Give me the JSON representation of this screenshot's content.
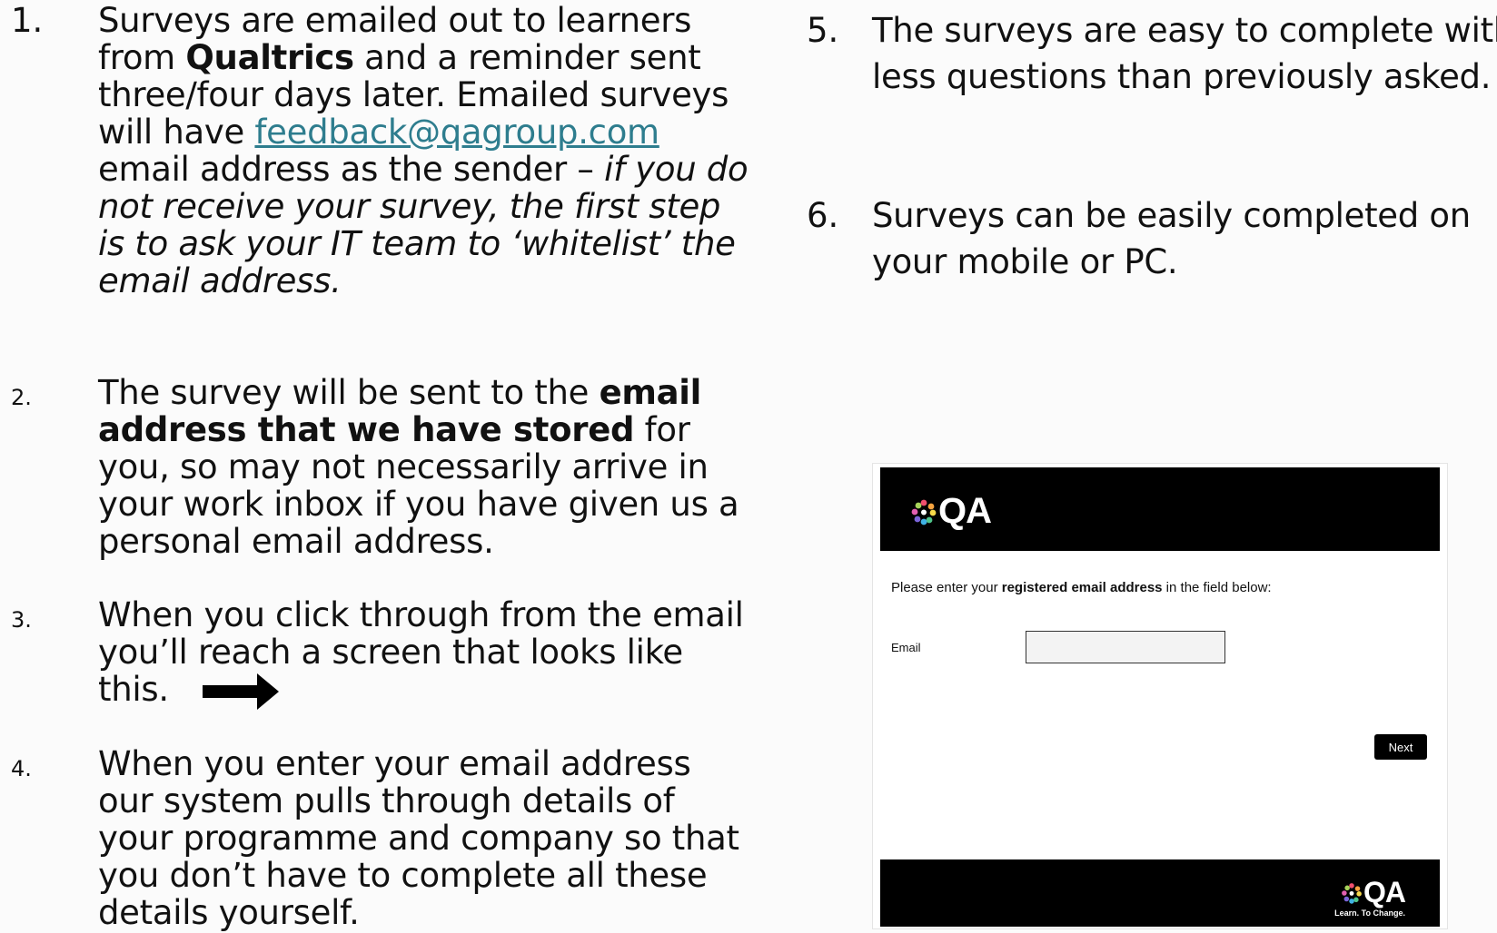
{
  "items": [
    {
      "number": "1.",
      "segments": [
        {
          "text": "Surveys are emailed out to learners from ",
          "style": "normal"
        },
        {
          "text": "Qualtrics",
          "style": "bold"
        },
        {
          "text": " and a reminder sent three/four days later. Emailed surveys will have ",
          "style": "normal"
        },
        {
          "text": "feedback@qagroup.com",
          "style": "link"
        },
        {
          "text": " email address as the sender – ",
          "style": "normal"
        },
        {
          "text": "if you do not receive your survey, the first step is to ask your IT team to ‘whitelist’ the email address.",
          "style": "italic"
        }
      ]
    },
    {
      "number": "2.",
      "segments": [
        {
          "text": "The survey will be sent to the ",
          "style": "normal"
        },
        {
          "text": "email address that we have stored",
          "style": "bold"
        },
        {
          "text": " for you, so may not necessarily arrive in your work inbox if you have given us a personal email address.",
          "style": "normal"
        }
      ]
    },
    {
      "number": "3.",
      "segments": [
        {
          "text": "When you click through from the email you’ll reach a screen that looks like this.",
          "style": "normal"
        }
      ]
    },
    {
      "number": "4.",
      "segments": [
        {
          "text": "When you enter your email address our system pulls through details of your programme and company so that you don’t have to complete all these details yourself.",
          "style": "normal"
        }
      ]
    },
    {
      "number": "5.",
      "segments": [
        {
          "text": "The surveys are easy to complete with less questions than previously asked.",
          "style": "normal"
        }
      ]
    },
    {
      "number": "6.",
      "segments": [
        {
          "text": "Surveys can be easily completed on your mobile or PC.",
          "style": "normal"
        }
      ]
    }
  ],
  "arrow_icon": "right-arrow-icon",
  "survey": {
    "logo_text": "QA",
    "footer_logo_text": "QA",
    "footer_tagline": "Learn. To Change.",
    "prompt": {
      "before": "Please enter your ",
      "bold": "registered email address",
      "after": " in the field below:"
    },
    "email_label": "Email",
    "email_value": "",
    "next_label": "Next",
    "logo_dot_colors": [
      "#ef4f6d",
      "#f7a440",
      "#f6d94a",
      "#4fc48a",
      "#3fb1e3",
      "#7b64d9",
      "#e35fb0",
      "#a7d35a"
    ]
  }
}
